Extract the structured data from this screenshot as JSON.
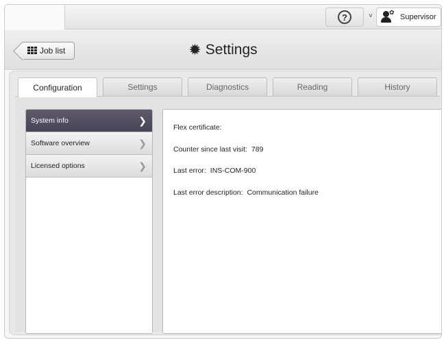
{
  "topbar": {
    "help_icon": "question-circle-icon",
    "help_glyph": "?",
    "user_chevron": "˅",
    "user_name": "Supervisor"
  },
  "header": {
    "back_label": "Job list",
    "title": "Settings"
  },
  "tabs": [
    {
      "label": "Configuration",
      "active": true
    },
    {
      "label": "Settings",
      "active": false
    },
    {
      "label": "Diagnostics",
      "active": false
    },
    {
      "label": "Reading",
      "active": false
    },
    {
      "label": "History",
      "active": false
    }
  ],
  "nav": {
    "items": [
      {
        "label": "System info",
        "active": true
      },
      {
        "label": "Software overview",
        "active": false
      },
      {
        "label": "Licensed options",
        "active": false
      }
    ]
  },
  "info": {
    "flex_label": "Flex certificate:",
    "counter_label": "Counter since last visit:",
    "counter_value": "789",
    "error_label": "Last error:",
    "error_value": "INS-COM-900",
    "error_desc_label": "Last error description:",
    "error_desc_value": "Communication failure"
  },
  "colors": {
    "active_nav": "#4f4b5e",
    "panel_bg": "#e3e3e3"
  }
}
